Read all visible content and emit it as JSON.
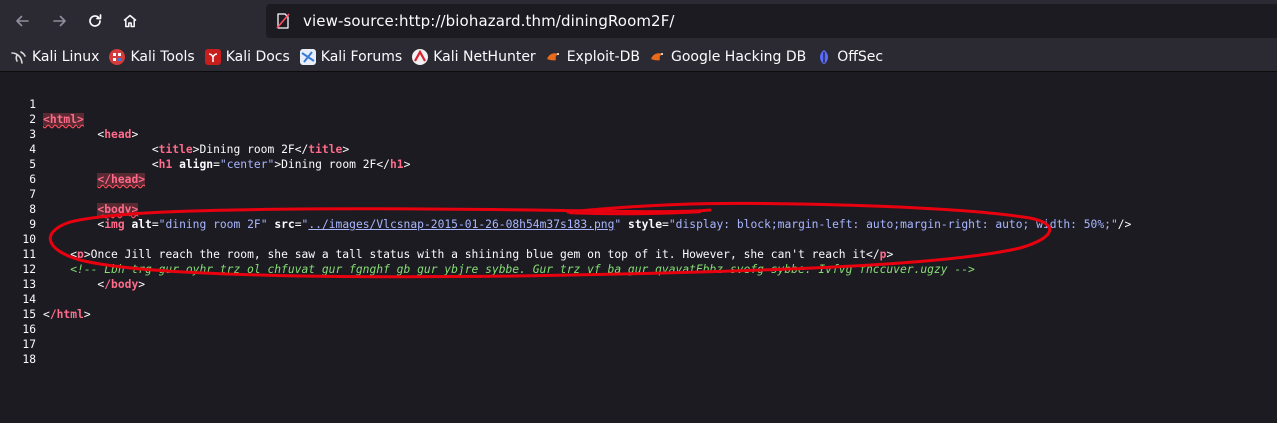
{
  "toolbar": {
    "url": "view-source:http://biohazard.thm/diningRoom2F/"
  },
  "bookmarks": [
    {
      "label": "Kali Linux",
      "icon": "kali-dragon-icon",
      "color": "#cccccc"
    },
    {
      "label": "Kali Tools",
      "icon": "kali-tools-icon",
      "color": "#d63b3b"
    },
    {
      "label": "Kali Docs",
      "icon": "kali-docs-icon",
      "color": "#c81e1e"
    },
    {
      "label": "Kali Forums",
      "icon": "kali-forums-icon",
      "color": "#3a7bd5"
    },
    {
      "label": "Kali NetHunter",
      "icon": "kali-nethunter-icon",
      "color": "#d8202f"
    },
    {
      "label": "Exploit-DB",
      "icon": "exploit-db-icon",
      "color": "#e86a1a"
    },
    {
      "label": "Google Hacking DB",
      "icon": "ghdb-icon",
      "color": "#e86a1a"
    },
    {
      "label": "OffSec",
      "icon": "offsec-icon",
      "color": "#5a6bff"
    }
  ],
  "source": {
    "line_numbers": [
      "1",
      "2",
      "3",
      "4",
      "5",
      "6",
      "7",
      "8",
      "9",
      "10",
      "11",
      "12",
      "13",
      "14",
      "15",
      "16",
      "17",
      "18"
    ],
    "l1": {
      "open": "<",
      "name": "html",
      "close": ">"
    },
    "l2": {
      "indent": "        ",
      "open": "<",
      "name": "head",
      "close": ">"
    },
    "l3": {
      "indent": "                ",
      "title_open": "title",
      "text": "Dining room 2F",
      "title_close": "title"
    },
    "l4": {
      "indent": "                ",
      "h1": "h1",
      "attr": "align",
      "val": "\"center\"",
      "text": "Dining room 2F",
      "h1_close": "h1"
    },
    "l5": {
      "indent": "        ",
      "name": "/head"
    },
    "l7": {
      "indent": "        ",
      "name": "body"
    },
    "l8": {
      "indent": "        ",
      "tag": "img",
      "attr1": "alt",
      "val1": "\"dining room 2F\"",
      "attr2": "src",
      "val2_q1": "\"",
      "val2_link": "../images/Vlcsnap-2015-01-26-08h54m37s183.png",
      "val2_q2": "\"",
      "attr3": "style",
      "val3": "\"display: block;margin-left: auto;margin-right: auto; width: 50%;\"",
      "end": "/>"
    },
    "l10": {
      "indent": "    ",
      "p": "p",
      "text": "Once Jill reach the room, she saw a tall status with a shiining blue gem on top of it. However, she can't reach it",
      "p_close": "p"
    },
    "l11": {
      "indent": "    ",
      "comment": "<!-- Lbh trg gur oyhr trz ol chfuvat gur fgnghf gb gur ybjre sybbe. Gur trz vf ba gur qvavatEbbz svefg sybbe. Ivfvg fnccuver.ugzy -->"
    },
    "l12": {
      "indent": "        ",
      "name": "/body"
    },
    "l14": {
      "name": "/html"
    }
  },
  "colors": {
    "tag": "#ff7de9",
    "attr_value": "#a8b6ff",
    "comment": "#86de74",
    "annotation": "#e8000f"
  }
}
